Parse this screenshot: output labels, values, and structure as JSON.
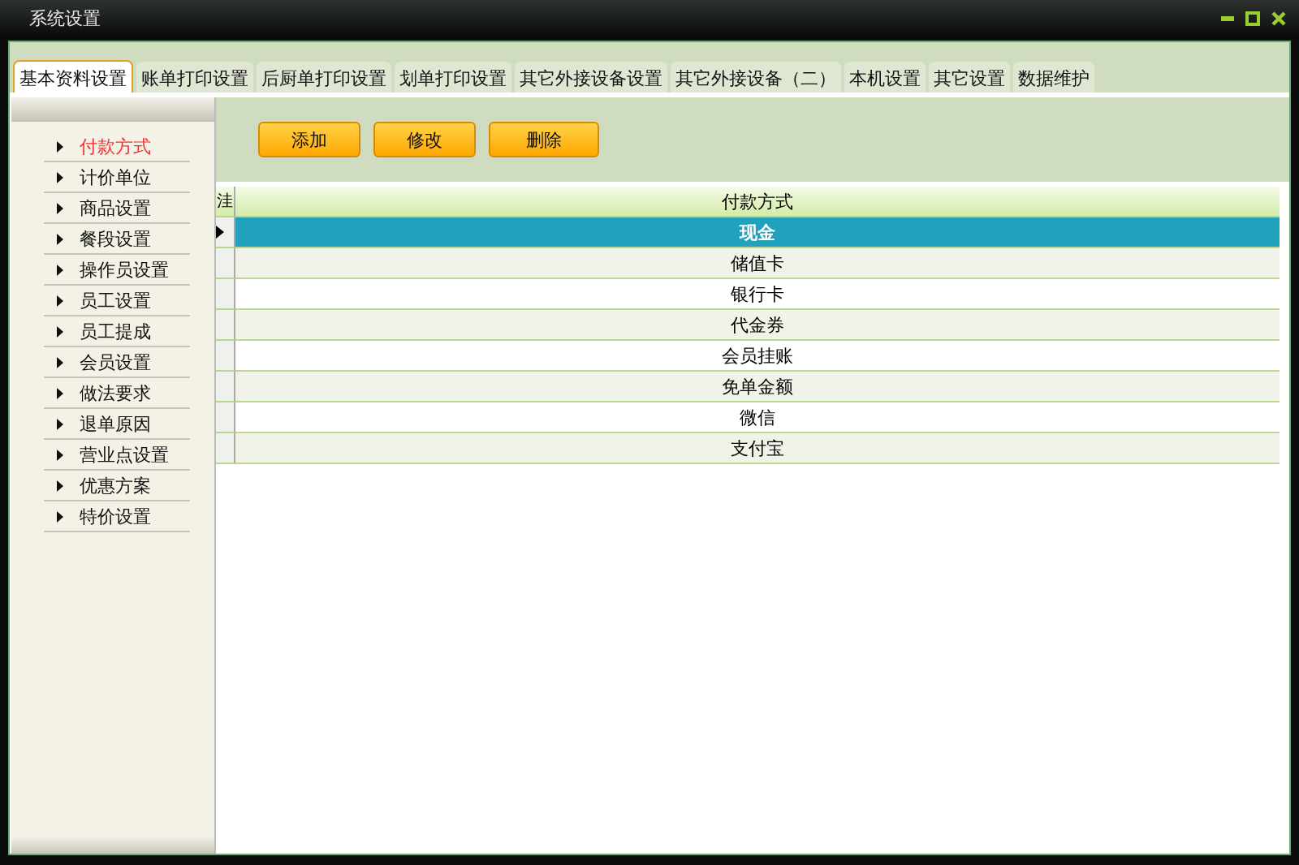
{
  "window": {
    "title": "系统设置"
  },
  "tabs": [
    {
      "label": "基本资料设置",
      "selected": true
    },
    {
      "label": "账单打印设置",
      "selected": false
    },
    {
      "label": "后厨单打印设置",
      "selected": false
    },
    {
      "label": "划单打印设置",
      "selected": false
    },
    {
      "label": "其它外接设备设置",
      "selected": false
    },
    {
      "label": "其它外接设备（二）",
      "selected": false
    },
    {
      "label": "本机设置",
      "selected": false
    },
    {
      "label": "其它设置",
      "selected": false
    },
    {
      "label": "数据维护",
      "selected": false
    }
  ],
  "sidebar": {
    "items": [
      {
        "label": "付款方式",
        "selected": true
      },
      {
        "label": "计价单位",
        "selected": false
      },
      {
        "label": "商品设置",
        "selected": false
      },
      {
        "label": "餐段设置",
        "selected": false
      },
      {
        "label": "操作员设置",
        "selected": false
      },
      {
        "label": "员工设置",
        "selected": false
      },
      {
        "label": "员工提成",
        "selected": false
      },
      {
        "label": "会员设置",
        "selected": false
      },
      {
        "label": "做法要求",
        "selected": false
      },
      {
        "label": "退单原因",
        "selected": false
      },
      {
        "label": "营业点设置",
        "selected": false
      },
      {
        "label": "优惠方案",
        "selected": false
      },
      {
        "label": "特价设置",
        "selected": false
      }
    ]
  },
  "toolbar": {
    "buttons": [
      "添加",
      "修改",
      "删除"
    ]
  },
  "table": {
    "corner": "洼",
    "columns": [
      "付款方式"
    ],
    "rows": [
      {
        "cells": [
          "现金"
        ],
        "selected": true
      },
      {
        "cells": [
          "储值卡"
        ],
        "selected": false
      },
      {
        "cells": [
          "银行卡"
        ],
        "selected": false
      },
      {
        "cells": [
          "代金券"
        ],
        "selected": false
      },
      {
        "cells": [
          "会员挂账"
        ],
        "selected": false
      },
      {
        "cells": [
          "免单金额"
        ],
        "selected": false
      },
      {
        "cells": [
          "微信"
        ],
        "selected": false
      },
      {
        "cells": [
          "支付宝"
        ],
        "selected": false
      }
    ]
  }
}
